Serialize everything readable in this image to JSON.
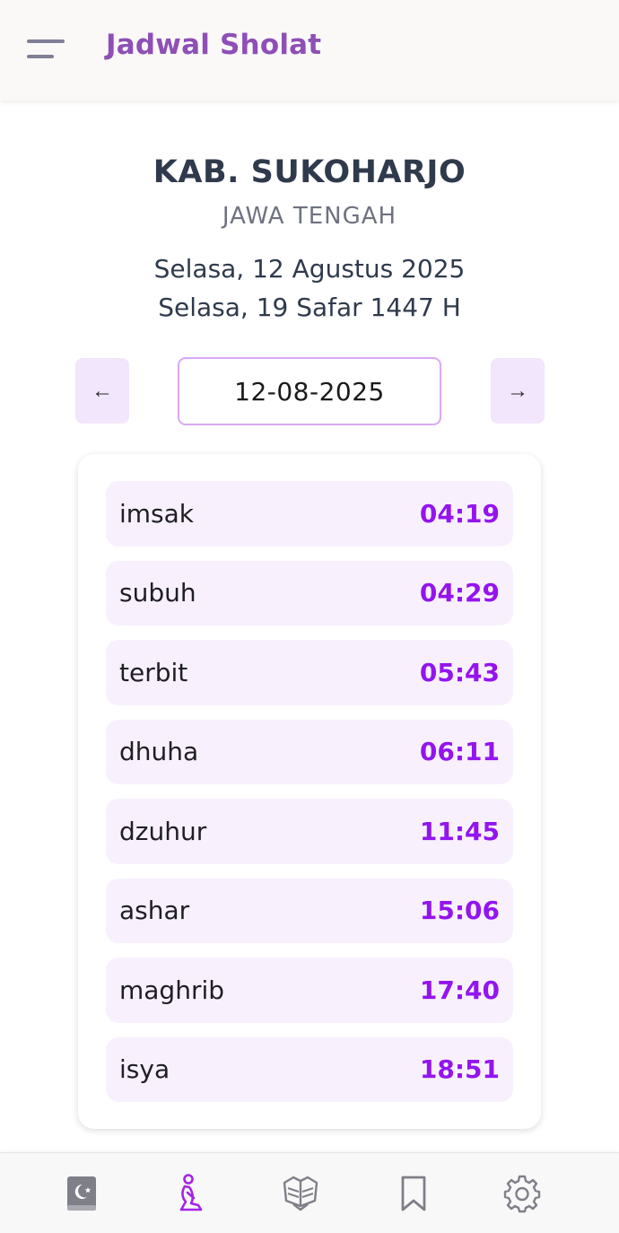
{
  "header": {
    "title": "Jadwal Sholat"
  },
  "location": {
    "name": "KAB. SUKOHARJO",
    "province": "JAWA TENGAH"
  },
  "dates": {
    "gregorian": "Selasa, 12 Agustus 2025",
    "hijri": "Selasa, 19 Safar 1447 H"
  },
  "date_nav": {
    "prev_label": "←",
    "next_label": "→",
    "selected_date": "12-08-2025"
  },
  "prayers": [
    {
      "name": "imsak",
      "time": "04:19"
    },
    {
      "name": "subuh",
      "time": "04:29"
    },
    {
      "name": "terbit",
      "time": "05:43"
    },
    {
      "name": "dhuha",
      "time": "06:11"
    },
    {
      "name": "dzuhur",
      "time": "11:45"
    },
    {
      "name": "ashar",
      "time": "15:06"
    },
    {
      "name": "maghrib",
      "time": "17:40"
    },
    {
      "name": "isya",
      "time": "18:51"
    }
  ],
  "bottom_nav": {
    "items": [
      {
        "icon": "quran-book-icon",
        "active": false
      },
      {
        "icon": "prayer-person-icon",
        "active": true
      },
      {
        "icon": "open-book-icon",
        "active": false
      },
      {
        "icon": "bookmark-icon",
        "active": false
      },
      {
        "icon": "gear-icon",
        "active": false
      }
    ]
  },
  "colors": {
    "accent": "#9414ee",
    "brand_title": "#8e4fb6",
    "row_background": "#f8f1fd",
    "nav_button_background": "#f1e6fc",
    "icon_inactive": "#7f7f88",
    "icon_active": "#a323e8"
  }
}
